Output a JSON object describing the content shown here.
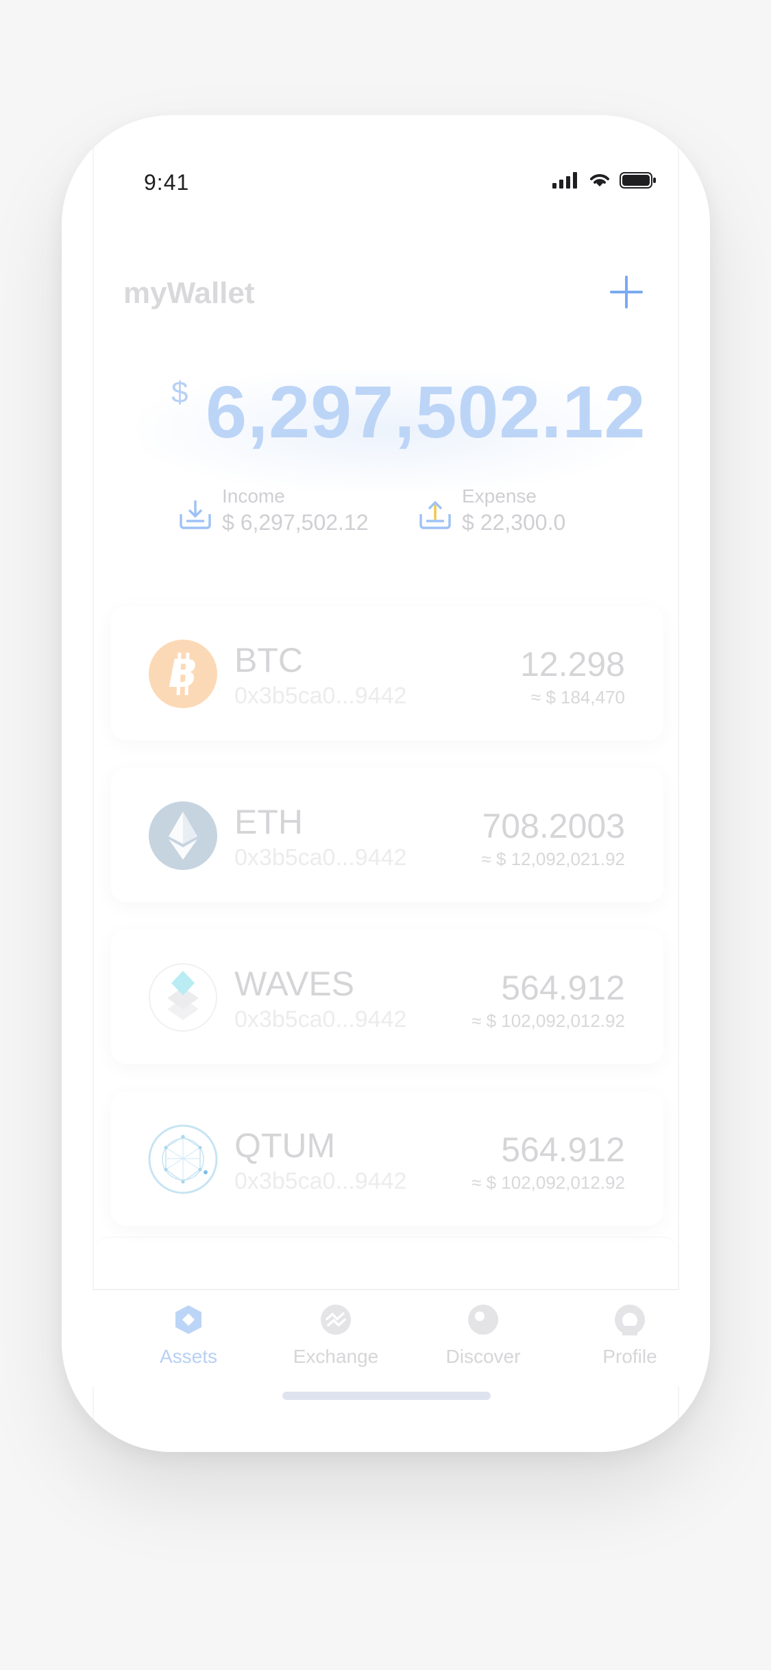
{
  "status_bar": {
    "time": "9:41"
  },
  "header": {
    "title": "myWallet"
  },
  "balance": {
    "currency": "$",
    "amount": "6,297,502.12"
  },
  "flows": {
    "income": {
      "label": "Income",
      "value": "$ 6,297,502.12"
    },
    "expense": {
      "label": "Expense",
      "value": "$ 22,300.0"
    }
  },
  "assets": [
    {
      "symbol": "BTC",
      "address": "0x3b5ca0...9442",
      "amount": "12.298",
      "usd": "≈ $ 184,470",
      "icon": "bitcoin-icon",
      "color": "#f7931a"
    },
    {
      "symbol": "ETH",
      "address": "0x3b5ca0...9442",
      "amount": "708.2003",
      "usd": "≈ $ 12,092,021.92",
      "icon": "ethereum-icon",
      "color": "#8aa6c0"
    },
    {
      "symbol": "WAVES",
      "address": "0x3b5ca0...9442",
      "amount": "564.912",
      "usd": "≈ $ 102,092,012.92",
      "icon": "waves-icon",
      "color": "#38d0e0"
    },
    {
      "symbol": "QTUM",
      "address": "0x3b5ca0...9442",
      "amount": "564.912",
      "usd": "≈ $ 102,092,012.92",
      "icon": "qtum-icon",
      "color": "#2e9ad0"
    }
  ],
  "tabbar": {
    "items": [
      {
        "label": "Assets",
        "icon": "assets-icon",
        "active": true
      },
      {
        "label": "Exchange",
        "icon": "exchange-icon",
        "active": false
      },
      {
        "label": "Discover",
        "icon": "discover-icon",
        "active": false
      },
      {
        "label": "Profile",
        "icon": "profile-icon",
        "active": false
      }
    ]
  },
  "colors": {
    "accent": "#5f9af0",
    "background": "#f6f6f7"
  }
}
